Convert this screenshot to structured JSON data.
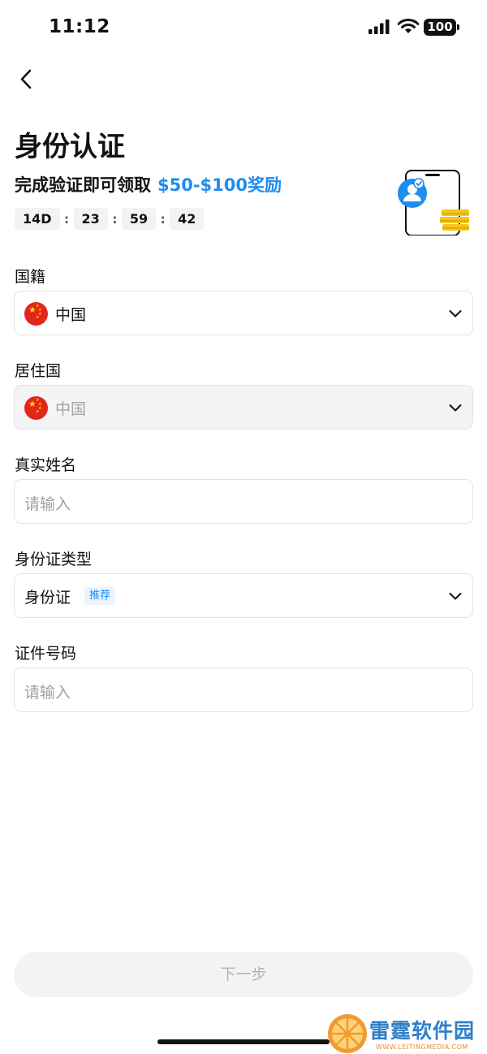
{
  "status_bar": {
    "time": "11:12",
    "battery": "100"
  },
  "header": {
    "title": "身份认证",
    "reward_text": "完成验证即可领取",
    "reward_amount": "$50-$100奖励",
    "countdown": [
      "14D",
      "23",
      "59",
      "42"
    ]
  },
  "form": {
    "nationality": {
      "label": "国籍",
      "value": "中国"
    },
    "residence": {
      "label": "居住国",
      "value": "中国"
    },
    "real_name": {
      "label": "真实姓名",
      "placeholder": "请输入"
    },
    "id_type": {
      "label": "身份证类型",
      "value": "身份证",
      "tag": "推荐"
    },
    "id_number": {
      "label": "证件号码",
      "placeholder": "请输入"
    }
  },
  "next_button_label": "下一步",
  "watermark": {
    "title": "雷霆软件园",
    "subtitle": "WWW.LEITINGMEDIA.COM"
  },
  "colors": {
    "accent": "#1f8cf0",
    "flag_red": "#e3261b",
    "flag_star": "#ffd800",
    "coin": "#f5c518"
  }
}
